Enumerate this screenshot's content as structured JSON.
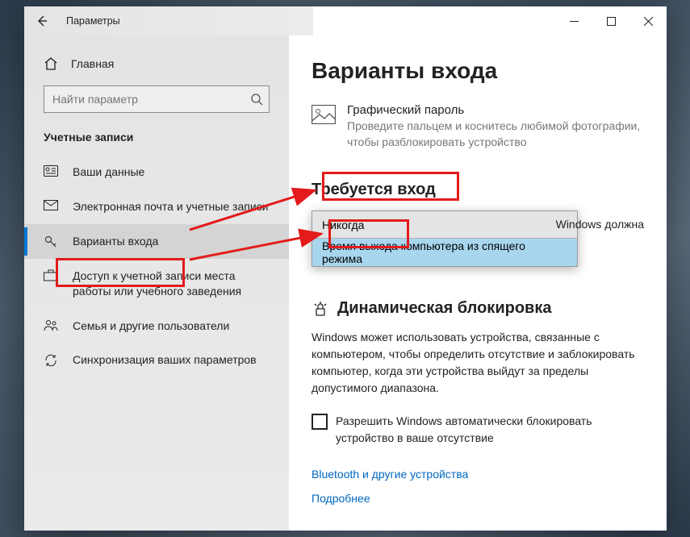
{
  "window": {
    "title": "Параметры"
  },
  "sidebar": {
    "home": "Главная",
    "search_placeholder": "Найти параметр",
    "section": "Учетные записи",
    "items": [
      {
        "label": "Ваши данные"
      },
      {
        "label": "Электронная почта и учетные записи"
      },
      {
        "label": "Варианты входа"
      },
      {
        "label": "Доступ к учетной записи места работы или учебного заведения"
      },
      {
        "label": "Семья и другие пользователи"
      },
      {
        "label": "Синхронизация ваших параметров"
      }
    ]
  },
  "content": {
    "page_title": "Варианты входа",
    "picture_pw": {
      "title": "Графический пароль",
      "desc": "Проведите пальцем и коснитесь любимой фотографии, чтобы разблокировать устройство"
    },
    "require_signin": {
      "title": "Требуется вход",
      "desc_tail": "Windows должна",
      "dropdown": {
        "current": "Никогда",
        "option": "Время выхода компьютера из спящего режима"
      }
    },
    "dynamic_lock": {
      "title": "Динамическая блокировка",
      "desc": "Windows может использовать устройства, связанные с компьютером, чтобы определить отсутствие и заблокировать компьютер, когда эти устройства выйдут за пределы допустимого диапазона.",
      "checkbox_label": "Разрешить Windows автоматически блокировать устройство в ваше отсутствие",
      "link1": "Bluetooth и другие устройства",
      "link2": "Подробнее"
    }
  }
}
